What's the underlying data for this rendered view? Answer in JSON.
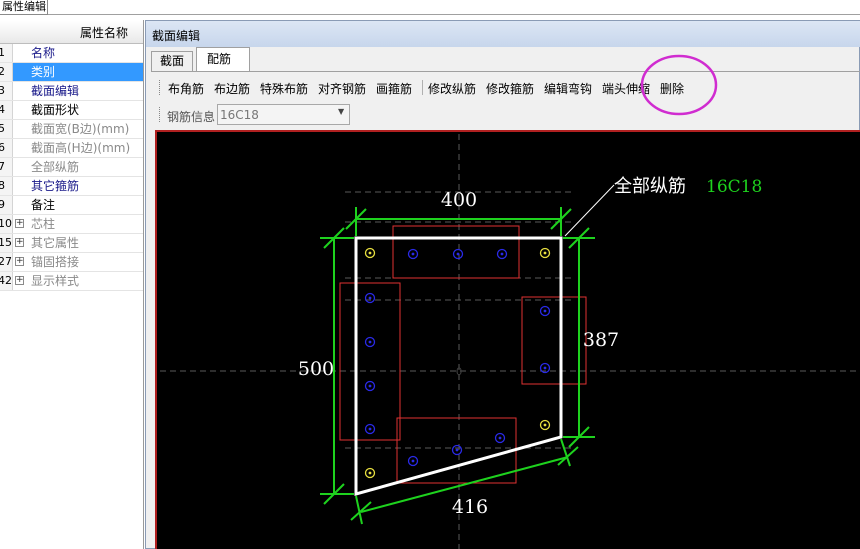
{
  "top_tab": "属性编辑",
  "properties": {
    "header": "属性名称",
    "rows": [
      {
        "num": "1",
        "label": "名称",
        "style": "blue",
        "selected": false,
        "expander": false
      },
      {
        "num": "2",
        "label": "类别",
        "style": "blue",
        "selected": true,
        "expander": false
      },
      {
        "num": "3",
        "label": "截面编辑",
        "style": "blue",
        "selected": false,
        "expander": false
      },
      {
        "num": "4",
        "label": "截面形状",
        "style": "black",
        "selected": false,
        "expander": false
      },
      {
        "num": "5",
        "label": "截面宽(B边)(mm)",
        "style": "gray",
        "selected": false,
        "expander": false
      },
      {
        "num": "6",
        "label": "截面高(H边)(mm)",
        "style": "gray",
        "selected": false,
        "expander": false
      },
      {
        "num": "7",
        "label": "全部纵筋",
        "style": "gray",
        "selected": false,
        "expander": false
      },
      {
        "num": "8",
        "label": "其它箍筋",
        "style": "blue",
        "selected": false,
        "expander": false
      },
      {
        "num": "9",
        "label": "备注",
        "style": "black",
        "selected": false,
        "expander": false
      },
      {
        "num": "10",
        "label": "芯柱",
        "style": "gray",
        "selected": false,
        "expander": true
      },
      {
        "num": "15",
        "label": "其它属性",
        "style": "gray",
        "selected": false,
        "expander": true
      },
      {
        "num": "27",
        "label": "锚固搭接",
        "style": "gray",
        "selected": false,
        "expander": true
      },
      {
        "num": "42",
        "label": "显示样式",
        "style": "gray",
        "selected": false,
        "expander": true
      }
    ],
    "expander_glyph": "+"
  },
  "editor": {
    "title": "截面编辑",
    "tabs": [
      "截面",
      "配筋"
    ],
    "active_tab": "配筋",
    "toolbar": [
      "布角筋",
      "布边筋",
      "特殊布筋",
      "对齐钢筋",
      "画箍筋",
      "修改纵筋",
      "修改箍筋",
      "编辑弯钩",
      "端头伸缩",
      "删除"
    ],
    "rebar_info_label": "钢筋信息",
    "rebar_info_value": "16C18",
    "dropdown_glyph": "▼"
  },
  "drawing": {
    "annotation_label": "全部纵筋",
    "annotation_value": "16C18",
    "dim_top": "400",
    "dim_left": "500",
    "dim_right": "387",
    "dim_bottom": "416",
    "origin_mark": "0"
  },
  "colors": {
    "canvas_bg": "#000000",
    "dimension": "#1ed21e",
    "outline": "#ffffff",
    "stirrup": "#e03232",
    "corner_bar": "#e8e040",
    "edge_bar": "#2a2ae8",
    "highlight_circle": "#d02cd0",
    "selection": "#3399ff"
  }
}
